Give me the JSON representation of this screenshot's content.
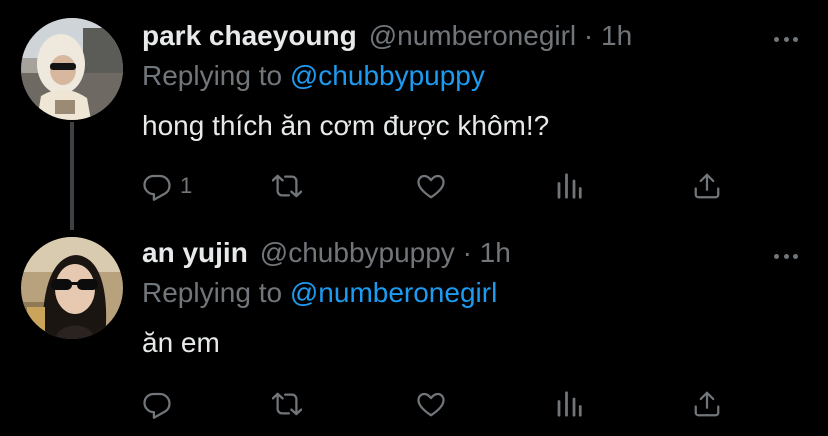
{
  "tweets": [
    {
      "name": "park chaeyoung",
      "handle": "@numberonegirl · 1h",
      "replying_prefix": "Replying to ",
      "replying_to": "@chubbypuppy",
      "text": "hong thích ăn cơm được khôm!?",
      "reply_count": "1"
    },
    {
      "name": "an yujin",
      "handle": "@chubbypuppy · 1h",
      "replying_prefix": "Replying to ",
      "replying_to": "@numberonegirl",
      "text": "ăn em",
      "reply_count": ""
    }
  ],
  "colors": {
    "background": "#000000",
    "text": "#e7e9ea",
    "muted": "#71767b",
    "link": "#1d9bf0",
    "thread_line": "#3e4144"
  },
  "icons": [
    "reply-icon",
    "retweet-icon",
    "like-icon",
    "stats-icon",
    "share-icon",
    "more-icon"
  ]
}
